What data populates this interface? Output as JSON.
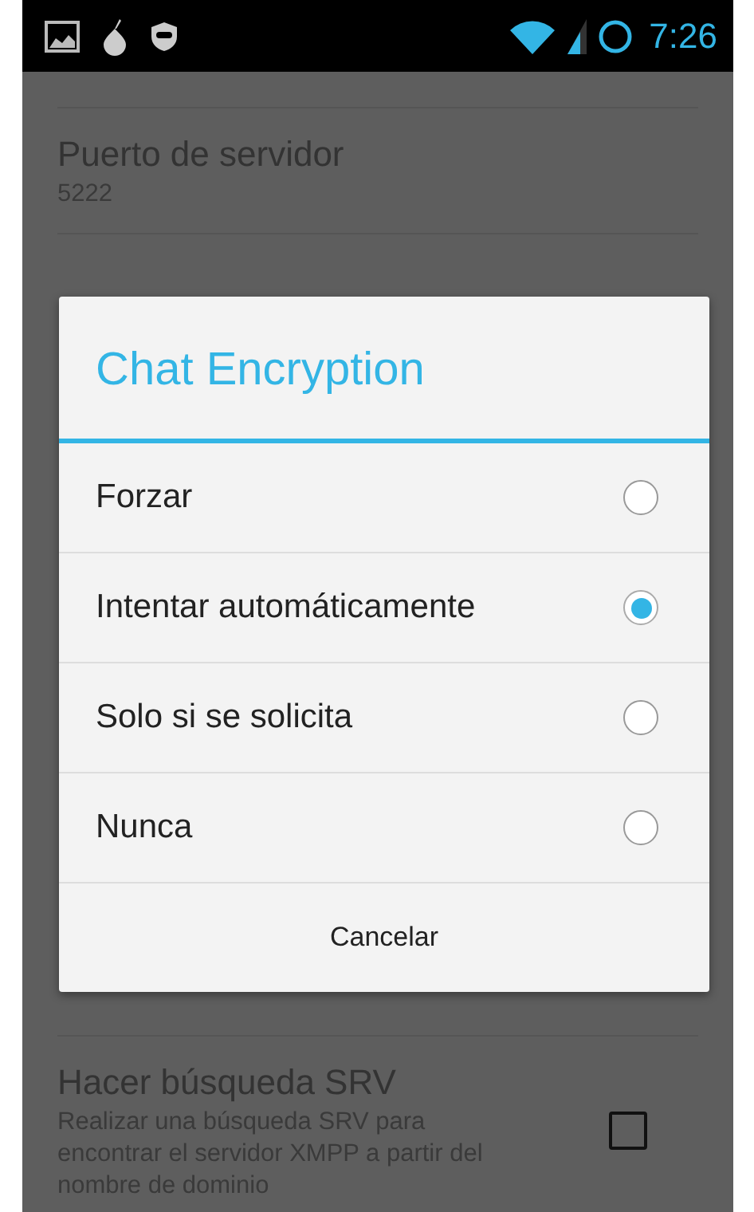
{
  "status_bar": {
    "time": "7:26"
  },
  "settings": [
    {
      "kind": "text",
      "title": "Puerto de servidor",
      "summary": "5222"
    },
    {
      "kind": "checkbox",
      "title": "Hacer búsqueda SRV",
      "summary": "Realizar una búsqueda SRV para encontrar el servidor XMPP a partir del nombre de dominio",
      "checked": false
    }
  ],
  "dialog": {
    "title": "Chat Encryption",
    "options": [
      {
        "label": "Forzar",
        "selected": false
      },
      {
        "label": "Intentar automáticamente",
        "selected": true
      },
      {
        "label": "Solo si se solicita",
        "selected": false
      },
      {
        "label": "Nunca",
        "selected": false
      }
    ],
    "cancel": "Cancelar"
  }
}
